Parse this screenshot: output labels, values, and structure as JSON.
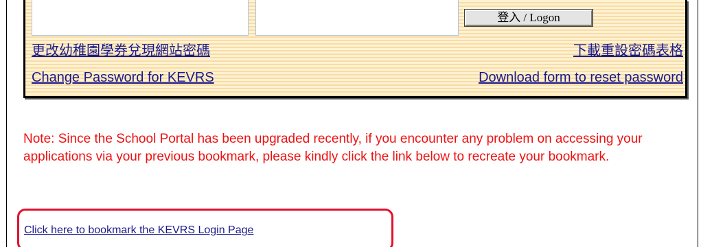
{
  "login": {
    "username_value": "",
    "password_value": "",
    "logon_button_label": "登入 / Logon"
  },
  "links": {
    "change_password_zh": "更改幼稚園學券兌現網站密碼",
    "download_form_zh": "下載重設密碼表格",
    "change_password_en": "Change Password for KEVRS",
    "download_form_en": "Download form to reset password"
  },
  "note": {
    "text": "Note: Since the School Portal has been upgraded recently, if you encounter any problem on accessing your applications via your previous bookmark, please kindly click the link below to recreate your bookmark.",
    "color": "#ee1111"
  },
  "bookmark": {
    "link_text": "Click here to bookmark the KEVRS Login Page",
    "highlight_color": "#e3102e"
  }
}
